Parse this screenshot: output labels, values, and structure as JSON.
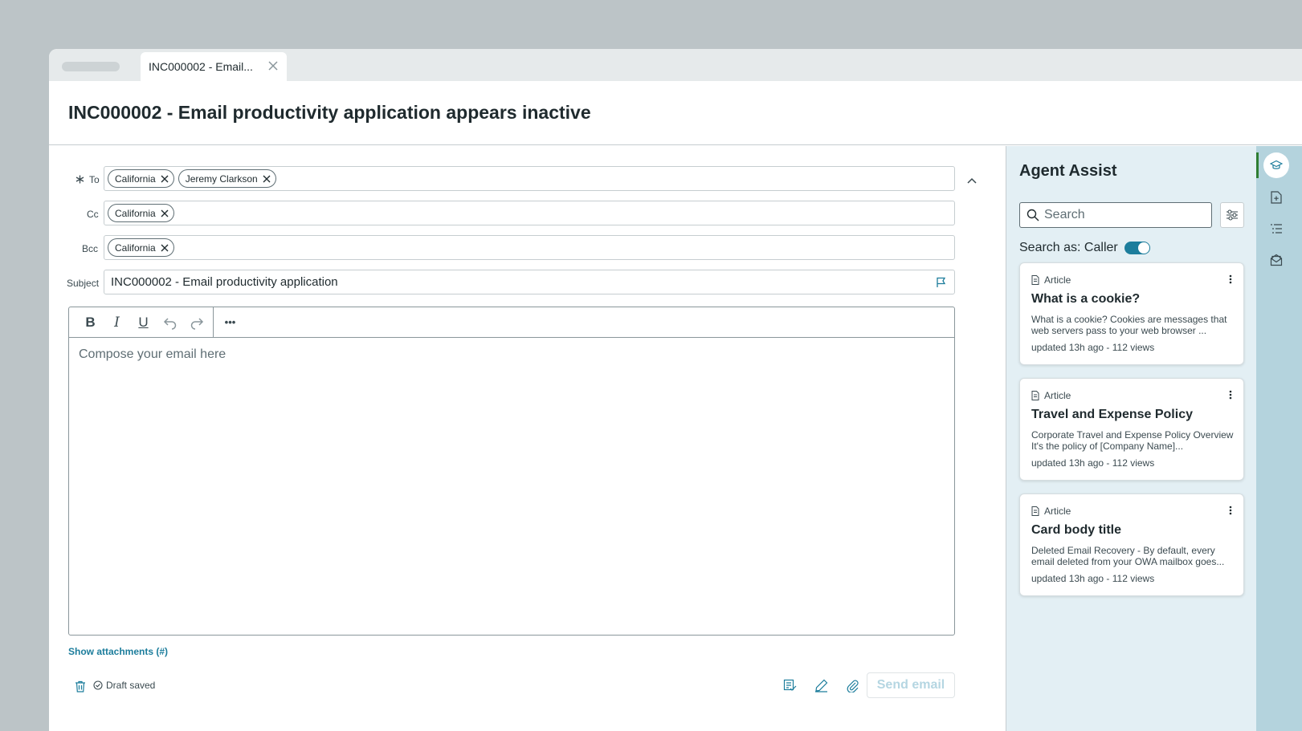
{
  "tab": {
    "label": "INC000002 - Email..."
  },
  "page": {
    "title": "INC000002 - Email productivity application appears inactive"
  },
  "compose": {
    "to_label": "To",
    "cc_label": "Cc",
    "bcc_label": "Bcc",
    "subject_label": "Subject",
    "to_chips": [
      "California",
      "Jeremy Clarkson"
    ],
    "cc_chips": [
      "California"
    ],
    "bcc_chips": [
      "California"
    ],
    "subject_value": "INC000002 - Email productivity application",
    "editor_placeholder": "Compose your email here",
    "toolbar": {
      "bold": "B",
      "italic": "I",
      "underline": "U",
      "more": "•••"
    },
    "show_attachments": "Show attachments (#)",
    "draft_status": "Draft saved",
    "send_label": "Send email"
  },
  "assist": {
    "title": "Agent Assist",
    "search_placeholder": "Search",
    "search_as": "Search as: Caller",
    "cards": [
      {
        "type": "Article",
        "title": "What is a cookie?",
        "desc": "What is a cookie? Cookies are messages that web servers pass to your web browser ...",
        "meta": "updated 13h ago - 112 views"
      },
      {
        "type": "Article",
        "title": "Travel and Expense Policy",
        "desc": "Corporate Travel and Expense Policy Overview It's the policy of [Company Name]...",
        "meta": "updated 13h ago - 112 views"
      },
      {
        "type": "Article",
        "title": "Card body title",
        "desc": "Deleted Email Recovery - By default, every email deleted from your OWA mailbox goes...",
        "meta": "updated 13h ago - 112 views"
      }
    ]
  },
  "icons": {
    "tab_close": "close-icon",
    "collapse": "chevron-up-icon",
    "flag": "flag-icon",
    "trash": "trash-icon",
    "check": "check-circle-icon",
    "rail": [
      "graduation-cap-icon",
      "document-add-icon",
      "list-icon",
      "inbox-icon"
    ]
  },
  "colors": {
    "accent": "#1c7d9c",
    "rail": "#b4d3dd",
    "panel": "#e3eff4"
  }
}
